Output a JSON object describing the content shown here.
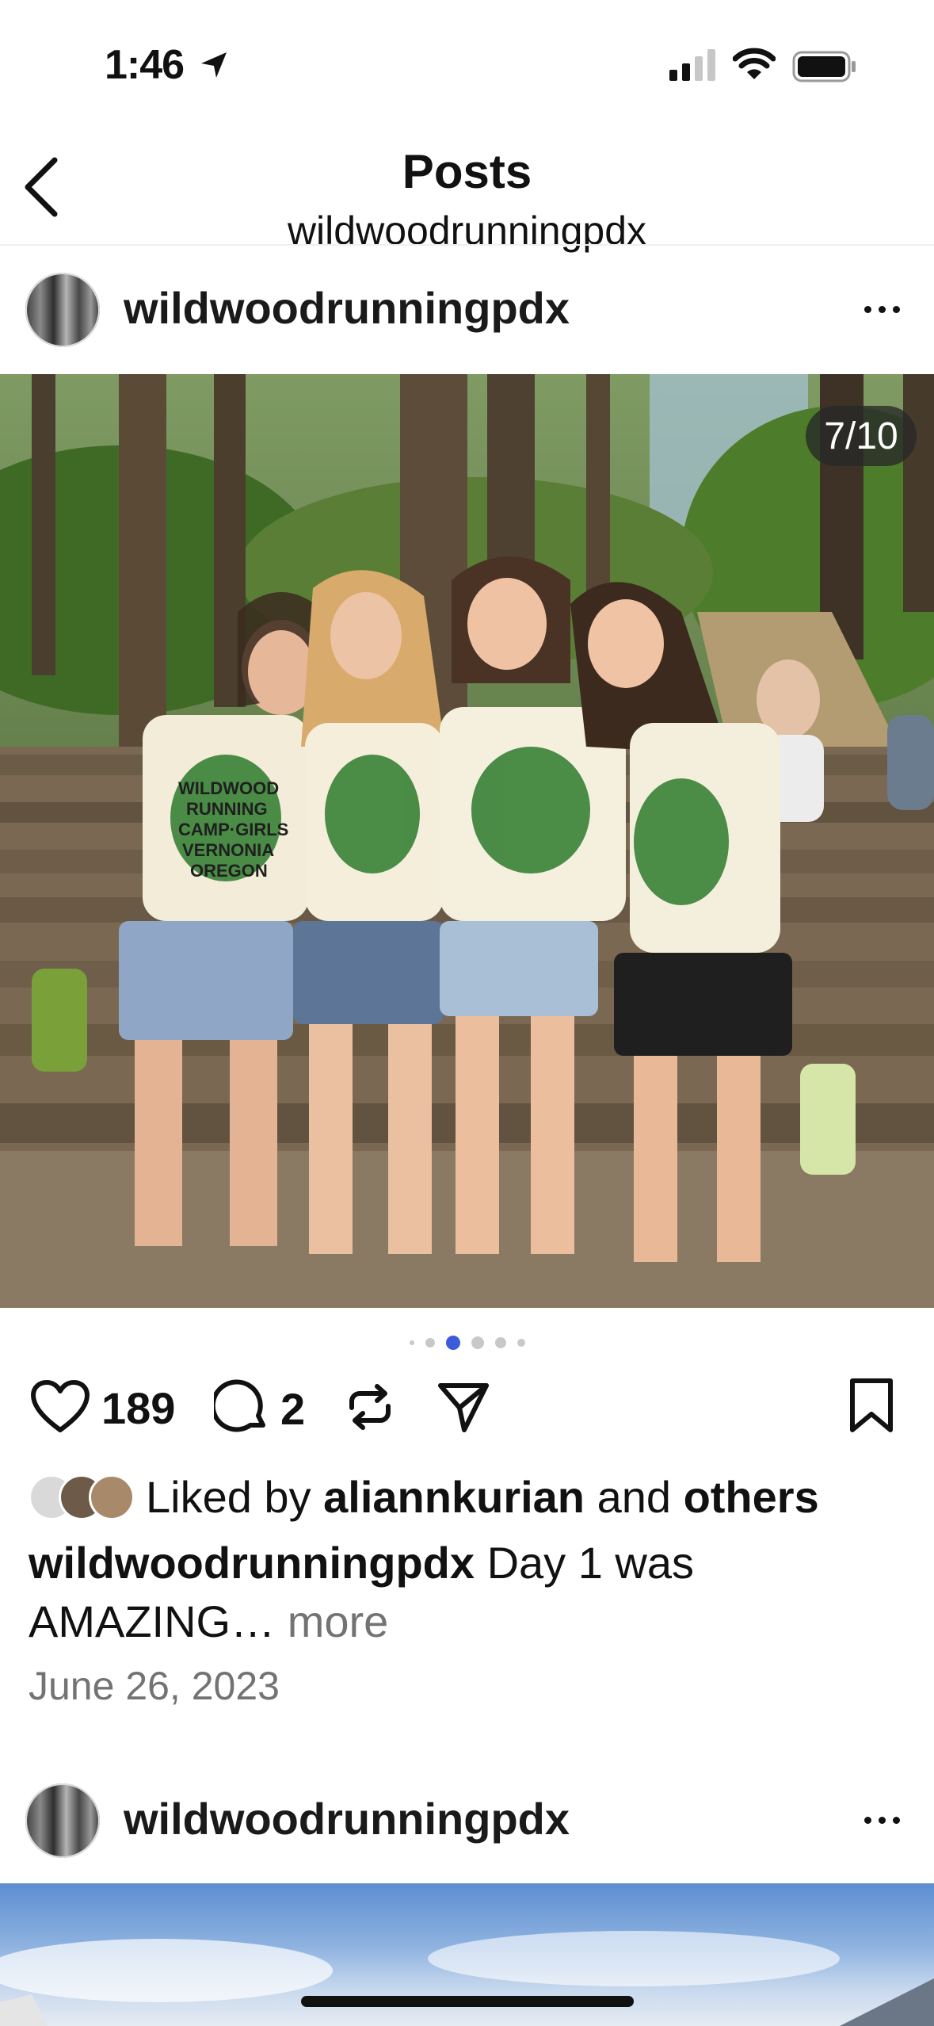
{
  "status_bar": {
    "time": "1:46"
  },
  "nav": {
    "title": "Posts",
    "subtitle": "wildwoodrunningpdx"
  },
  "post": {
    "username": "wildwoodrunningpdx",
    "image_counter": "7/10",
    "carousel_active_index": 2,
    "likes_count": "189",
    "comments_count": "2",
    "liked_by_prefix": "Liked by",
    "liked_by_user": "aliannkurian",
    "liked_by_and": "and",
    "liked_by_others": "others",
    "caption_user": "wildwoodrunningpdx",
    "caption_text": "Day 1 was AMAZING…",
    "caption_more": "more",
    "date": "June 26, 2023",
    "shirt_text": [
      "WILDWOOD",
      "RUNNING",
      "CAMP·GIRLS",
      "VERNONIA",
      "OREGON"
    ]
  },
  "next_post": {
    "username": "wildwoodrunningpdx"
  },
  "colors": {
    "accent_dot": "#3b5bdb",
    "muted_text": "#737373"
  },
  "icons": [
    "location-arrow-icon",
    "cellular-signal-icon",
    "wifi-icon",
    "battery-icon",
    "back-chevron-icon",
    "more-icon",
    "heart-icon",
    "comment-icon",
    "repost-icon",
    "share-icon",
    "bookmark-icon"
  ]
}
